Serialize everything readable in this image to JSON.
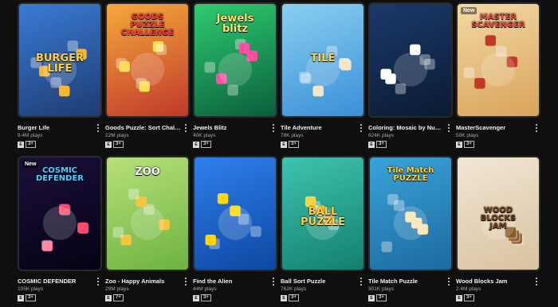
{
  "games": [
    {
      "id": "burger-life",
      "title": "Burger Life",
      "plays": "9.4M plays",
      "age": "3+",
      "art": "BURGER\nLIFE",
      "new": false,
      "colors": {
        "bg1": "#3a7bd5",
        "bg2": "#1e3c72",
        "accent": "#f7b733",
        "text": "#ffd23f"
      }
    },
    {
      "id": "goods-puzzle",
      "title": "Goods Puzzle: Sort Challenge",
      "plays": "22M plays",
      "age": "3+",
      "art": "GOODS\nPUZZLE\nCHALLENGE",
      "new": false,
      "colors": {
        "bg1": "#f6a93b",
        "bg2": "#c0392b",
        "accent": "#ffdd57",
        "text": "#ff3b3b"
      }
    },
    {
      "id": "jewels-blitz",
      "title": "Jewels Blitz",
      "plays": "40K plays",
      "age": "3+",
      "art": "Jewels\nblitz",
      "new": false,
      "colors": {
        "bg1": "#2ecc71",
        "bg2": "#0b5e3b",
        "accent": "#ff4fa3",
        "text": "#ffe66d"
      }
    },
    {
      "id": "tile-adventure",
      "title": "Tile Adventure",
      "plays": "78K plays",
      "age": "3+",
      "art": "TILE",
      "new": false,
      "colors": {
        "bg1": "#89cff0",
        "bg2": "#3a8fd8",
        "accent": "#f5e6c8",
        "text": "#ffd23f"
      }
    },
    {
      "id": "coloring-mosaic",
      "title": "Coloring: Mosaic by Numbers",
      "plays": "624K plays",
      "age": "3+",
      "art": "",
      "new": false,
      "colors": {
        "bg1": "#1a3a6b",
        "bg2": "#0b1a33",
        "accent": "#ffffff",
        "text": "#ffffff"
      }
    },
    {
      "id": "master-scavenger",
      "title": "MasterScavenger",
      "plays": "59K plays",
      "age": "3+",
      "art": "MASTER\nSCAVENGER",
      "new": true,
      "colors": {
        "bg1": "#f3d9a4",
        "bg2": "#d9a35b",
        "accent": "#c0392b",
        "text": "#e74c3c"
      }
    },
    {
      "id": "cosmic-defender",
      "title": "COSMIC DEFENDER",
      "plays": "105K plays",
      "age": "3+",
      "art": "COSMIC\nDEFENDER",
      "new": true,
      "colors": {
        "bg1": "#1b0f3a",
        "bg2": "#050214",
        "accent": "#ff4b6e",
        "text": "#4fd1ff"
      }
    },
    {
      "id": "zoo-happy-animals",
      "title": "Zoo - Happy Animals",
      "plays": "29M plays",
      "age": "7+",
      "art": "ZOO",
      "new": false,
      "colors": {
        "bg1": "#b7e07a",
        "bg2": "#6db33f",
        "accent": "#f5c542",
        "text": "#ffffff"
      }
    },
    {
      "id": "find-the-alien",
      "title": "Find the Alien",
      "plays": "44M plays",
      "age": "3+",
      "art": "",
      "new": false,
      "colors": {
        "bg1": "#2f80ed",
        "bg2": "#0d47a1",
        "accent": "#ffd600",
        "text": "#ff3b3b"
      }
    },
    {
      "id": "ball-sort-puzzle",
      "title": "Ball Sort Puzzle",
      "plays": "762K plays",
      "age": "3+",
      "art": "BALL\nPUZZLE",
      "new": false,
      "colors": {
        "bg1": "#3fc3b0",
        "bg2": "#13806f",
        "accent": "#ffd23f",
        "text": "#ffd23f"
      }
    },
    {
      "id": "tile-match-puzzle",
      "title": "Tile Match Puzzle",
      "plays": "901K plays",
      "age": "3+",
      "art": "Tile Match\nPUZZLE",
      "new": false,
      "colors": {
        "bg1": "#3aa3d9",
        "bg2": "#1c6aa0",
        "accent": "#f7e3b0",
        "text": "#ffd23f"
      }
    },
    {
      "id": "wood-blocks-jam",
      "title": "Wood Blocks Jam",
      "plays": "2.4M plays",
      "age": "3+",
      "art": "WOOD\nBLOCKS\nJAM",
      "new": false,
      "colors": {
        "bg1": "#f2e6d4",
        "bg2": "#d9c2a0",
        "accent": "#8b5a2b",
        "text": "#6b3e1c"
      }
    }
  ],
  "labels": {
    "more_options": "more-options",
    "new_badge": "New",
    "esrb": "E"
  }
}
